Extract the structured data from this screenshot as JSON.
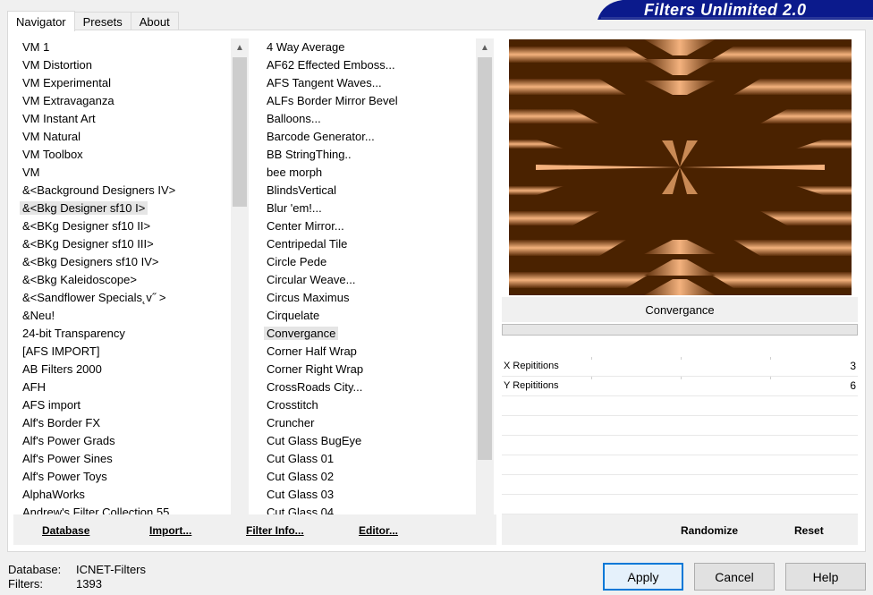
{
  "app": {
    "title": "Filters Unlimited 2.0"
  },
  "tabs": [
    {
      "label": "Navigator",
      "active": true
    },
    {
      "label": "Presets",
      "active": false
    },
    {
      "label": "About",
      "active": false
    }
  ],
  "categories": {
    "items": [
      "VM 1",
      "VM Distortion",
      "VM Experimental",
      "VM Extravaganza",
      "VM Instant Art",
      "VM Natural",
      "VM Toolbox",
      "VM",
      "&<Background Designers IV>",
      "&<Bkg Designer sf10 I>",
      "&<BKg Designer sf10 II>",
      "&<BKg Designer sf10 III>",
      "&<Bkg Designers sf10 IV>",
      "&<Bkg Kaleidoscope>",
      "&<Sandflower Specials˛v˝ >",
      "&Neu!",
      "24-bit Transparency",
      "[AFS IMPORT]",
      "AB Filters 2000",
      "AFH",
      "AFS import",
      "Alf's Border FX",
      "Alf's Power Grads",
      "Alf's Power Sines",
      "Alf's Power Toys",
      "AlphaWorks",
      "Andrew's Filter Collection 55"
    ],
    "selected": "&<Bkg Designer sf10 I>"
  },
  "filters": {
    "items": [
      "4 Way Average",
      "AF62 Effected Emboss...",
      "AFS Tangent Waves...",
      "ALFs Border Mirror Bevel",
      "Balloons...",
      "Barcode Generator...",
      "BB StringThing..",
      "bee morph",
      "BlindsVertical",
      "Blur 'em!...",
      "Center Mirror...",
      "Centripedal Tile",
      "Circle Pede",
      "Circular Weave...",
      "Circus Maximus",
      "Cirquelate",
      "Convergance",
      "Corner Half Wrap",
      "Corner Right Wrap",
      "CrossRoads City...",
      "Crosstitch",
      "Cruncher",
      "Cut Glass  BugEye",
      "Cut Glass 01",
      "Cut Glass 02",
      "Cut Glass 03",
      "Cut Glass 04"
    ],
    "selected": "Convergance"
  },
  "left_buttons": {
    "database": "Database",
    "import": "Import...",
    "filter_info": "Filter Info...",
    "editor": "Editor..."
  },
  "filter_name": "Convergance",
  "progress": 0,
  "params": [
    {
      "label": "X Repititions",
      "value": "3"
    },
    {
      "label": "Y Repititions",
      "value": "6"
    }
  ],
  "right_buttons": {
    "randomize": "Randomize",
    "reset": "Reset"
  },
  "status": {
    "database_label": "Database:",
    "database_value": "ICNET-Filters",
    "filters_label": "Filters:",
    "filters_value": "1393"
  },
  "dialog": {
    "apply": "Apply",
    "cancel": "Cancel",
    "help": "Help"
  },
  "colors": {
    "preview_dark": "#4a2200",
    "preview_light": "#f4b27e",
    "banner": "#0b1a8c",
    "default_border": "#0078d7"
  }
}
